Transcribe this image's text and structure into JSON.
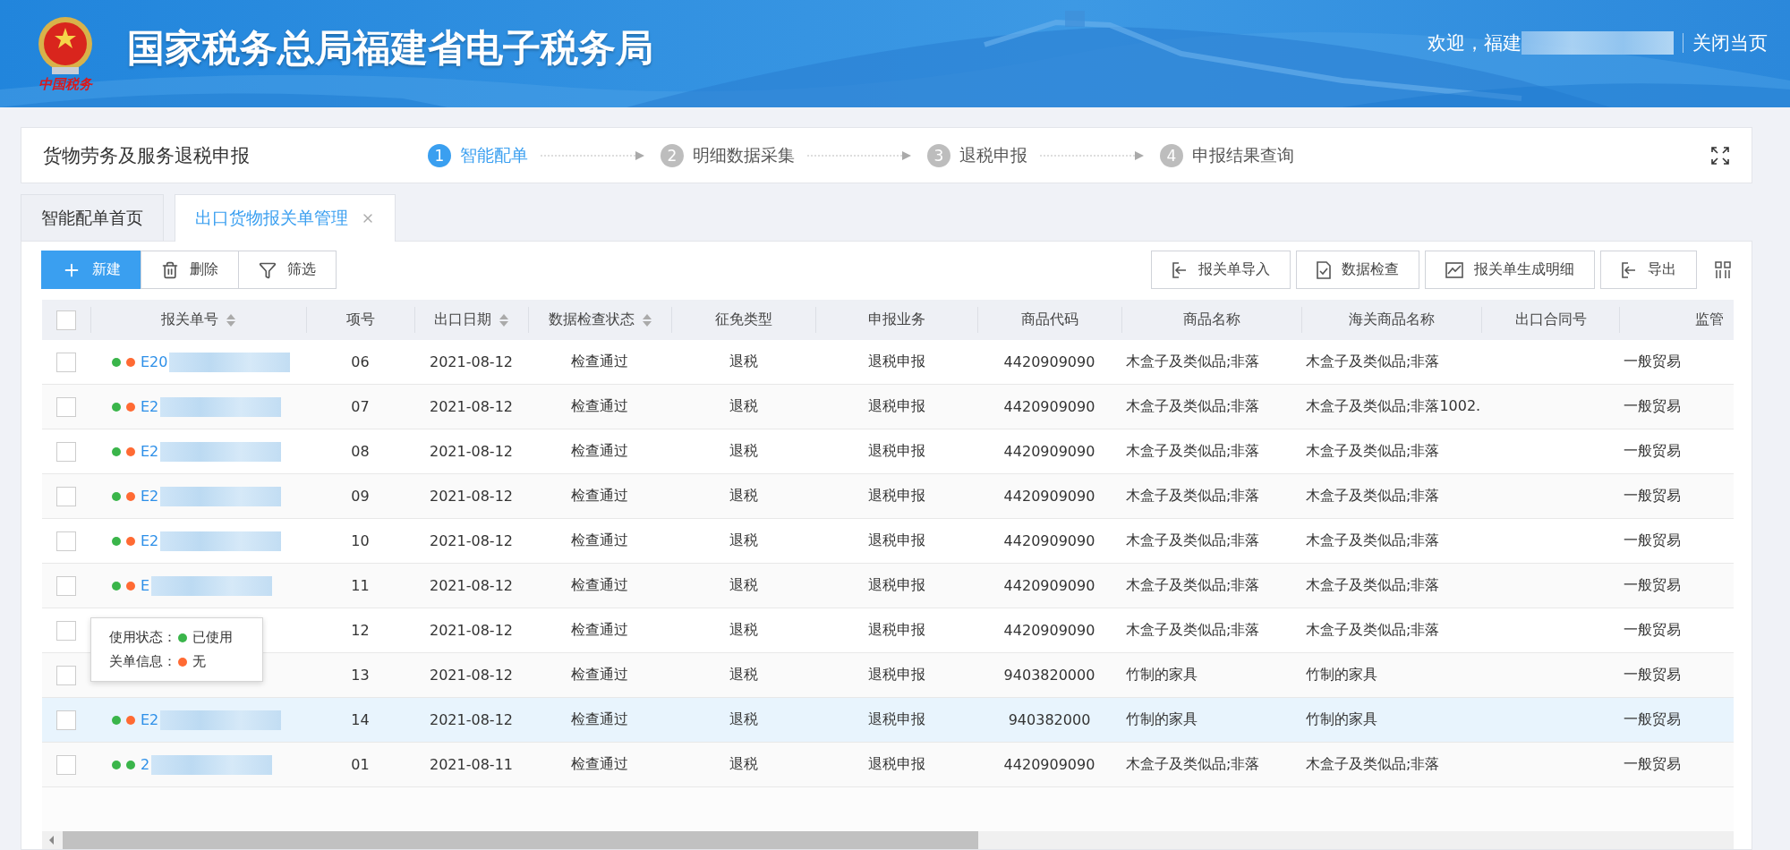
{
  "header": {
    "logo_text": "中国税务",
    "title": "国家税务总局福建省电子税务局",
    "welcome": "欢迎，福建",
    "close_link": "关闭当页"
  },
  "page_card": {
    "title": "货物劳务及服务退税申报",
    "steps": [
      {
        "number": "1",
        "label": "智能配单",
        "selected": true
      },
      {
        "number": "2",
        "label": "明细数据采集",
        "selected": false
      },
      {
        "number": "3",
        "label": "退税申报",
        "selected": false
      },
      {
        "number": "4",
        "label": "申报结果查询",
        "selected": false
      }
    ]
  },
  "tabs": [
    {
      "label": "智能配单首页",
      "selected": false,
      "closable": false
    },
    {
      "label": "出口货物报关单管理",
      "selected": true,
      "closable": true
    }
  ],
  "toolbar": {
    "left": [
      {
        "label": "新建",
        "kind": "add",
        "primary": true
      },
      {
        "label": "删除",
        "kind": "delete",
        "primary": false
      },
      {
        "label": "筛选",
        "kind": "filter",
        "primary": false
      }
    ],
    "right": [
      {
        "label": "报关单导入",
        "kind": "import"
      },
      {
        "label": "数据检查",
        "kind": "check"
      },
      {
        "label": "报关单生成明细",
        "kind": "chart"
      },
      {
        "label": "导出",
        "kind": "export"
      }
    ]
  },
  "table": {
    "all_checked": false,
    "columns": [
      {
        "label": "报关单号",
        "sortable": true
      },
      {
        "label": "项号",
        "sortable": false
      },
      {
        "label": "出口日期",
        "sortable": true
      },
      {
        "label": "数据检查状态",
        "sortable": true
      },
      {
        "label": "征免类型",
        "sortable": false
      },
      {
        "label": "申报业务",
        "sortable": false
      },
      {
        "label": "商品代码",
        "sortable": false
      },
      {
        "label": "商品名称",
        "sortable": false
      },
      {
        "label": "海关商品名称",
        "sortable": false
      },
      {
        "label": "出口合同号",
        "sortable": false
      },
      {
        "label": "监管",
        "sortable": false
      }
    ],
    "rows": [
      {
        "checked": false,
        "highlighted": false,
        "dots": [
          {
            "color": "#3ab54a"
          },
          {
            "color": "#ff6a33"
          }
        ],
        "cells": [
          "E20",
          "06",
          "2021-08-12",
          "检查通过",
          "退税",
          "退税申报",
          "4420909090",
          "木盒子及类似品;非落",
          "木盒子及类似品;非落",
          null,
          "一般贸易"
        ]
      },
      {
        "checked": false,
        "highlighted": false,
        "dots": [
          {
            "color": "#3ab54a"
          },
          {
            "color": "#ff6a33"
          }
        ],
        "cells": [
          "E2",
          "07",
          "2021-08-12",
          "检查通过",
          "退税",
          "退税申报",
          "4420909090",
          "木盒子及类似品;非落",
          "木盒子及类似品;非落1002.",
          null,
          "一般贸易"
        ]
      },
      {
        "checked": false,
        "highlighted": false,
        "dots": [
          {
            "color": "#3ab54a"
          },
          {
            "color": "#ff6a33"
          }
        ],
        "cells": [
          "E2",
          "08",
          "2021-08-12",
          "检查通过",
          "退税",
          "退税申报",
          "4420909090",
          "木盒子及类似品;非落",
          "木盒子及类似品;非落",
          null,
          "一般贸易"
        ]
      },
      {
        "checked": false,
        "highlighted": false,
        "dots": [
          {
            "color": "#3ab54a"
          },
          {
            "color": "#ff6a33"
          }
        ],
        "cells": [
          "E2",
          "09",
          "2021-08-12",
          "检查通过",
          "退税",
          "退税申报",
          "4420909090",
          "木盒子及类似品;非落",
          "木盒子及类似品;非落",
          null,
          "一般贸易"
        ]
      },
      {
        "checked": false,
        "highlighted": false,
        "dots": [
          {
            "color": "#3ab54a"
          },
          {
            "color": "#ff6a33"
          }
        ],
        "cells": [
          "E2",
          "10",
          "2021-08-12",
          "检查通过",
          "退税",
          "退税申报",
          "4420909090",
          "木盒子及类似品;非落",
          "木盒子及类似品;非落",
          null,
          "一般贸易"
        ]
      },
      {
        "checked": false,
        "highlighted": false,
        "dots": [
          {
            "color": "#3ab54a"
          },
          {
            "color": "#ff6a33"
          }
        ],
        "cells": [
          "E",
          "11",
          "2021-08-12",
          "检查通过",
          "退税",
          "退税申报",
          "4420909090",
          "木盒子及类似品;非落",
          "木盒子及类似品;非落",
          null,
          "一般贸易"
        ]
      },
      {
        "checked": false,
        "highlighted": false,
        "cells": [
          null,
          "12",
          "2021-08-12",
          "检查通过",
          "退税",
          "退税申报",
          "4420909090",
          "木盒子及类似品;非落",
          "木盒子及类似品;非落",
          null,
          "一般贸易"
        ]
      },
      {
        "checked": false,
        "highlighted": false,
        "cells": [
          null,
          "13",
          "2021-08-12",
          "检查通过",
          "退税",
          "退税申报",
          "9403820000",
          "竹制的家具",
          "竹制的家具",
          null,
          "一般贸易"
        ]
      },
      {
        "checked": false,
        "highlighted": true,
        "dots": [
          {
            "color": "#3ab54a"
          },
          {
            "color": "#ff6a33"
          }
        ],
        "cells": [
          "E2",
          "14",
          "2021-08-12",
          "检查通过",
          "退税",
          "退税申报",
          "940382000",
          "竹制的家具",
          "竹制的家具",
          null,
          "一般贸易"
        ]
      },
      {
        "checked": false,
        "highlighted": false,
        "dots": [
          {
            "color": "#3ab54a"
          },
          {
            "color": "#3ab54a"
          }
        ],
        "cells": [
          "2",
          "01",
          "2021-08-11",
          "检查通过",
          "退税",
          "退税申报",
          "4420909090",
          "木盒子及类似品;非落",
          "木盒子及类似品;非落",
          null,
          "一般贸易"
        ]
      }
    ]
  },
  "tooltip": {
    "lines": [
      {
        "label": "使用状态：",
        "color": "#3ab54a",
        "value": "已使用"
      },
      {
        "label": "关单信息：",
        "color": "#ff6a33",
        "value": "无"
      }
    ]
  }
}
